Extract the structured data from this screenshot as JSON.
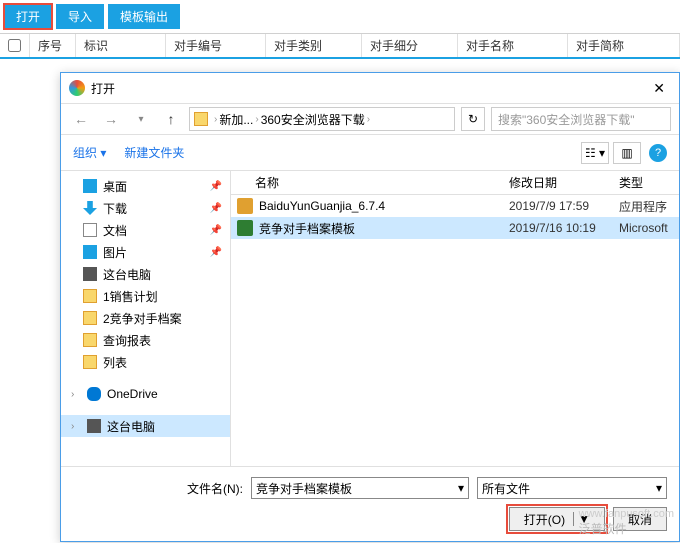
{
  "toolbar": {
    "open": "打开",
    "import": "导入",
    "template_out": "模板输出"
  },
  "table": {
    "seq": "序号",
    "mark": "标识",
    "opp_no": "对手编号",
    "opp_type": "对手类别",
    "opp_detail": "对手细分",
    "opp_name": "对手名称",
    "opp_short": "对手简称"
  },
  "dialog": {
    "title": "打开",
    "breadcrumb": {
      "p1": "新加...",
      "p2": "360安全浏览器下载"
    },
    "search_placeholder": "搜索\"360安全浏览器下载\"",
    "organize": "组织",
    "new_folder": "新建文件夹",
    "tree": {
      "desktop": "桌面",
      "downloads": "下载",
      "documents": "文档",
      "pictures": "图片",
      "this_pc": "这台电脑",
      "f_sales": "1销售计划",
      "f_opp": "2竞争对手档案",
      "f_query": "查询报表",
      "f_list": "列表",
      "onedrive": "OneDrive",
      "this_pc2": "这台电脑"
    },
    "cols": {
      "name": "名称",
      "date": "修改日期",
      "type": "类型"
    },
    "files": [
      {
        "name": "BaiduYunGuanjia_6.7.4",
        "date": "2019/7/9 17:59",
        "type": "应用程序"
      },
      {
        "name": "竞争对手档案模板",
        "date": "2019/7/16 10:19",
        "type": "Microsoft"
      }
    ],
    "filename_label": "文件名(N):",
    "filename_value": "竞争对手档案模板",
    "filter": "所有文件",
    "open_btn": "打开(O)",
    "cancel_btn": "取消"
  },
  "watermark": "泛普软件"
}
